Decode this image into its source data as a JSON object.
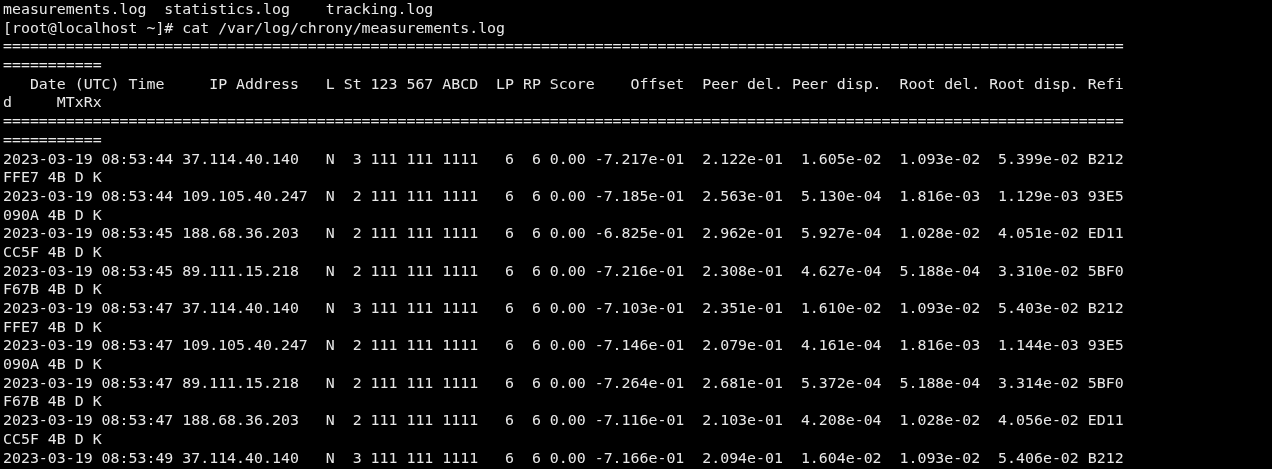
{
  "terminal": {
    "lines": [
      "measurements.log  statistics.log    tracking.log",
      "[root@localhost ~]# cat /var/log/chrony/measurements.log",
      "=============================================================================================================================",
      "===========",
      "   Date (UTC) Time     IP Address   L St 123 567 ABCD  LP RP Score    Offset  Peer del. Peer disp.  Root del. Root disp. Refi",
      "d     MTxRx",
      "=============================================================================================================================",
      "===========",
      "2023-03-19 08:53:44 37.114.40.140   N  3 111 111 1111   6  6 0.00 -7.217e-01  2.122e-01  1.605e-02  1.093e-02  5.399e-02 B212",
      "FFE7 4B D K",
      "2023-03-19 08:53:44 109.105.40.247  N  2 111 111 1111   6  6 0.00 -7.185e-01  2.563e-01  5.130e-04  1.816e-03  1.129e-03 93E5",
      "090A 4B D K",
      "2023-03-19 08:53:45 188.68.36.203   N  2 111 111 1111   6  6 0.00 -6.825e-01  2.962e-01  5.927e-04  1.028e-02  4.051e-02 ED11",
      "CC5F 4B D K",
      "2023-03-19 08:53:45 89.111.15.218   N  2 111 111 1111   6  6 0.00 -7.216e-01  2.308e-01  4.627e-04  5.188e-04  3.310e-02 5BF0",
      "F67B 4B D K",
      "2023-03-19 08:53:47 37.114.40.140   N  3 111 111 1111   6  6 0.00 -7.103e-01  2.351e-01  1.610e-02  1.093e-02  5.403e-02 B212",
      "FFE7 4B D K",
      "2023-03-19 08:53:47 109.105.40.247  N  2 111 111 1111   6  6 0.00 -7.146e-01  2.079e-01  4.161e-04  1.816e-03  1.144e-03 93E5",
      "090A 4B D K",
      "2023-03-19 08:53:47 89.111.15.218   N  2 111 111 1111   6  6 0.00 -7.264e-01  2.681e-01  5.372e-04  5.188e-04  3.314e-02 5BF0",
      "F67B 4B D K",
      "2023-03-19 08:53:47 188.68.36.203   N  2 111 111 1111   6  6 0.00 -7.116e-01  2.103e-01  4.208e-04  1.028e-02  4.056e-02 ED11",
      "CC5F 4B D K",
      "2023-03-19 08:53:49 37.114.40.140   N  3 111 111 1111   6  6 0.00 -7.166e-01  2.094e-01  1.604e-02  1.093e-02  5.406e-02 B212"
    ]
  }
}
